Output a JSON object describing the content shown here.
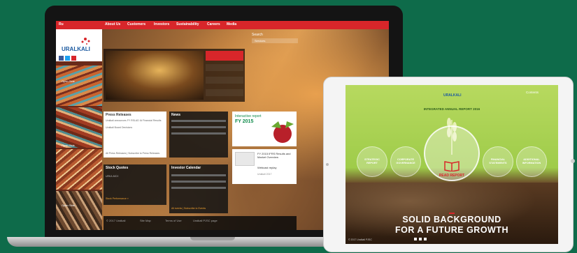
{
  "website": {
    "nav": {
      "brand_tag": "Ru",
      "items": [
        "About Us",
        "Customers",
        "Investors",
        "Sustainability",
        "Careers",
        "Media"
      ]
    },
    "logo_text": "URALKALI",
    "search": {
      "label": "Search",
      "placeholder": "Services"
    },
    "side_labels": [
      "Open Side",
      "Open Side",
      "Open Side"
    ],
    "press_releases": {
      "title": "Press Releases",
      "items": [
        "Uralkali announces FY RSLAD IA Financial Results",
        "Uralkali Board Decisions"
      ],
      "footer": "All Press Releases | Subscribe to Press Releases"
    },
    "news": {
      "title": "News"
    },
    "interactive_report": {
      "title": "Interactive report",
      "year": "FY 2015"
    },
    "results": {
      "title": "FY 2015 IFRS Results and Market Overview",
      "webcast": "Webcast replay",
      "footer": "Uralkali 2017"
    },
    "stock_quotes": {
      "title": "Stock Quotes",
      "ticker": "URKA.MCX",
      "footer": "Stock Performance »"
    },
    "investor_calendar": {
      "title": "Investor Calendar",
      "footer": "All events | Subscribe to Events"
    },
    "footer": {
      "copyright": "© 2017 Uralkali",
      "links": [
        "Site Map",
        "Terms of Use",
        "Uralkali PJSC page"
      ]
    }
  },
  "tablet": {
    "logo_text": "URALKALI",
    "report_title": "INTEGRATED ANNUAL REPORT 2016",
    "contents_label": "Contents",
    "circles": [
      "STRATEGIC REPORT",
      "CORPORATE GOVERNANCE",
      "FINANCIAL STATEMENTS",
      "ADDITIONAL INFORMATION"
    ],
    "read_report": "READ REPORT",
    "headline_1": "SOLID BACKGROUND",
    "headline_2": "FOR A FUTURE GROWTH",
    "footer_copyright": "© 2017 Uralkali PJSC"
  },
  "colors": {
    "background": "#0e6b4a",
    "accent_red": "#d8262a",
    "tablet_green": "#9fcc4a"
  }
}
